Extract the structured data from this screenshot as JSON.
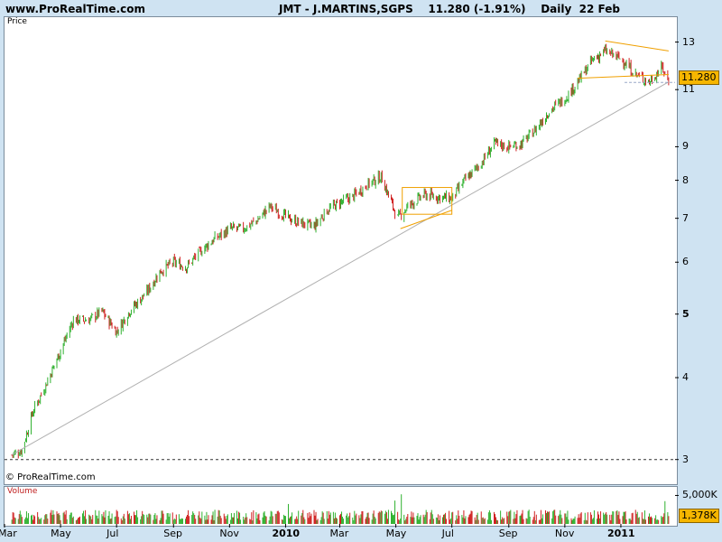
{
  "header": {
    "site": "www.ProRealTime.com",
    "quote": "JMT - J.MARTINS,SGPS    11.280 (-1.91%)    Daily  22 Feb"
  },
  "price_panel": {
    "label": "Price",
    "copyright": "© ProRealTime.com",
    "last_badge": "11.280",
    "y_ticks": [
      "13",
      "11",
      "9",
      "8",
      "7",
      "6",
      "5",
      "4",
      "3"
    ]
  },
  "volume_panel": {
    "label": "Volume",
    "y_ticks": [
      "5,000K"
    ],
    "last_badge": "1,378K"
  },
  "x_ticks": [
    {
      "label": "Mar",
      "bold": false
    },
    {
      "label": "May",
      "bold": false
    },
    {
      "label": "Jul",
      "bold": false
    },
    {
      "label": "Sep",
      "bold": false
    },
    {
      "label": "Nov",
      "bold": false
    },
    {
      "label": "2010",
      "bold": true
    },
    {
      "label": "Mar",
      "bold": false
    },
    {
      "label": "May",
      "bold": false
    },
    {
      "label": "Jul",
      "bold": false
    },
    {
      "label": "Sep",
      "bold": false
    },
    {
      "label": "Nov",
      "bold": false
    },
    {
      "label": "2011",
      "bold": true
    }
  ],
  "colors": {
    "up": "#2fb12f",
    "down": "#d02020",
    "pattern": "#f0a000",
    "trendline": "#b0b0b0",
    "baseline": "#303030"
  },
  "chart_data": [
    {
      "type": "line",
      "title": "JMT - J.MARTINS,SGPS",
      "xlabel": "",
      "ylabel": "Price",
      "log_scale": true,
      "ylim": [
        2.95,
        13.4
      ],
      "x": [
        "2009-03-09",
        "2009-03-20",
        "2009-04-01",
        "2009-04-15",
        "2009-05-01",
        "2009-05-15",
        "2009-06-01",
        "2009-06-15",
        "2009-07-01",
        "2009-07-15",
        "2009-08-03",
        "2009-08-17",
        "2009-09-01",
        "2009-09-15",
        "2009-10-01",
        "2009-10-15",
        "2009-11-02",
        "2009-11-16",
        "2009-12-01",
        "2009-12-15",
        "2010-01-04",
        "2010-01-15",
        "2010-02-01",
        "2010-02-15",
        "2010-03-01",
        "2010-03-15",
        "2010-04-01",
        "2010-04-15",
        "2010-05-03",
        "2010-05-14",
        "2010-06-01",
        "2010-06-15",
        "2010-07-01",
        "2010-07-15",
        "2010-08-02",
        "2010-08-16",
        "2010-09-01",
        "2010-09-15",
        "2010-10-01",
        "2010-10-15",
        "2010-11-02",
        "2010-11-15",
        "2010-12-01",
        "2010-12-15",
        "2011-01-03",
        "2011-01-17",
        "2011-02-01",
        "2011-02-15",
        "2011-02-22"
      ],
      "y": [
        3.05,
        3.1,
        3.55,
        3.9,
        4.4,
        4.9,
        4.9,
        5.05,
        4.7,
        5.05,
        5.4,
        5.8,
        6.0,
        5.9,
        6.25,
        6.5,
        6.75,
        6.75,
        6.95,
        7.3,
        7.0,
        6.9,
        6.8,
        7.2,
        7.4,
        7.55,
        7.9,
        8.1,
        7.0,
        7.3,
        7.6,
        7.55,
        7.5,
        8.0,
        8.5,
        9.1,
        9.0,
        9.1,
        9.6,
        10.2,
        10.7,
        11.3,
        12.2,
        12.6,
        12.2,
        11.6,
        11.3,
        11.9,
        11.28
      ],
      "last": 11.28,
      "annotations": [
        {
          "type": "trendline",
          "from": [
            "2009-03-09",
            3.05
          ],
          "to": [
            "2011-02-22",
            11.3
          ]
        },
        {
          "type": "rectangle",
          "x": [
            "2010-05-08",
            "2010-07-01"
          ],
          "y": [
            7.1,
            7.8
          ]
        },
        {
          "type": "line",
          "from": [
            "2010-05-06",
            6.75
          ],
          "to": [
            "2010-07-01",
            7.2
          ]
        },
        {
          "type": "line",
          "from": [
            "2010-11-15",
            11.45
          ],
          "to": [
            "2011-02-22",
            11.6
          ]
        },
        {
          "type": "line",
          "from": [
            "2010-12-15",
            13.05
          ],
          "to": [
            "2011-02-22",
            12.6
          ]
        },
        {
          "type": "support",
          "y": 3.0
        }
      ]
    },
    {
      "type": "bar",
      "title": "Volume",
      "ylabel": "Volume",
      "ylim": [
        0,
        6500
      ],
      "unit": "K",
      "last": 1378,
      "typical": [
        600,
        2500
      ],
      "peaks": [
        {
          "date": "2010-01-04",
          "value": 3500
        },
        {
          "date": "2010-04-30",
          "value": 4100
        },
        {
          "date": "2010-05-07",
          "value": 5200
        },
        {
          "date": "2010-11-20",
          "value": 4300
        },
        {
          "date": "2011-02-18",
          "value": 4000
        }
      ]
    }
  ]
}
